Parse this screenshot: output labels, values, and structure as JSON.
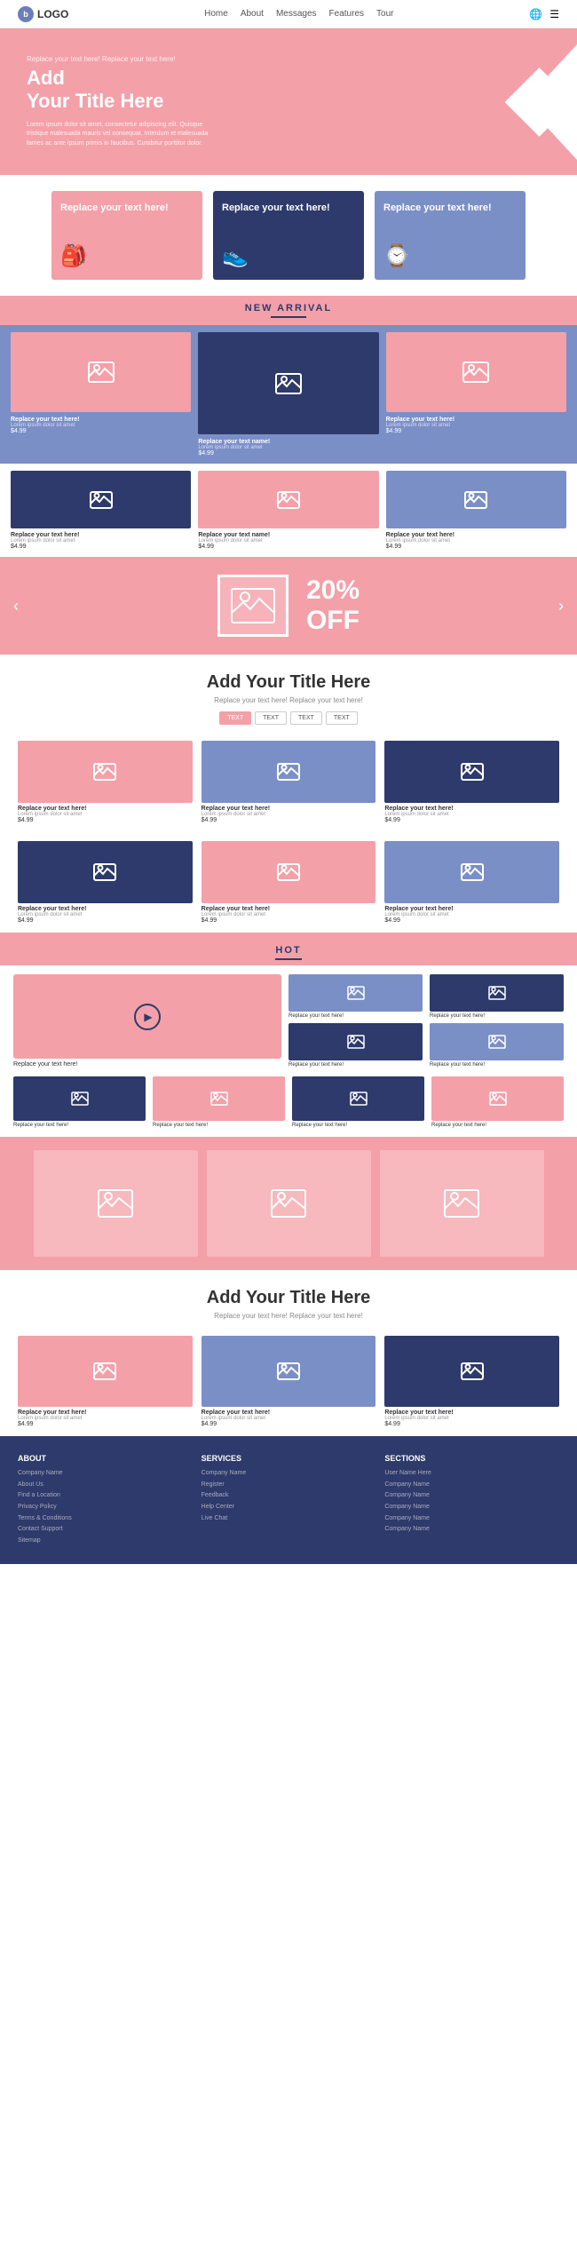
{
  "navbar": {
    "logo": "LOGO",
    "links": [
      "Home",
      "About",
      "Messages",
      "Features",
      "Tour"
    ],
    "icons": [
      "globe",
      "menu"
    ]
  },
  "hero": {
    "pre_title": "Replace your text here! Replace your text here!",
    "title": "Add\nYour Title Here",
    "body": "Lorem ipsum dolor sit amet, consectetur adipiscing elit. Quisque tristique malesuada mauris vel consequat. Interdum et malesuada fames ac ante ipsum primis in faucibus. Curabitur porttitor dolor."
  },
  "cards_row": [
    {
      "title": "Replace your text here!",
      "color": "pink"
    },
    {
      "title": "Replace your text here!",
      "color": "dark"
    },
    {
      "title": "Replace your text here!",
      "color": "blue"
    }
  ],
  "new_arrival": {
    "label": "NEW ARRIVAL"
  },
  "products_row1": [
    {
      "name": "Replace your text here!",
      "desc": "Lorem ipsum dolor sit amet",
      "price": "$4.99"
    },
    {
      "name": "Replace your text name!",
      "desc": "Lorem ipsum dolor sit amet",
      "price": "$4.99"
    },
    {
      "name": "Replace your text here!",
      "desc": "Lorem ipsum dolor sit amet",
      "price": "$4.99"
    }
  ],
  "products_row2": [
    {
      "name": "Replace your text here!",
      "desc": "Lorem ipsum dolor sit amet",
      "price": "$4.99"
    },
    {
      "name": "Replace your text name!",
      "desc": "Lorem ipsum dolor sit amet",
      "price": "$4.99"
    },
    {
      "name": "Replace your text here!",
      "desc": "Lorem ipsum dolor sit amet",
      "price": "$4.99"
    }
  ],
  "banner_sale": {
    "discount": "20%",
    "label": "OFF"
  },
  "section2_title": "Add Your Title Here",
  "section2_subtitle": "Replace your text here!  Replace your text here!",
  "section2_tabs": [
    "TEXT",
    "TEXT",
    "TEXT",
    "TEXT"
  ],
  "products_s2_row1": [
    {
      "name": "Replace your text here!",
      "desc": "Lorem ipsum dolor sit amet",
      "price": "$4.99"
    },
    {
      "name": "Replace your text here!",
      "desc": "Lorem ipsum dolor sit amet",
      "price": "$4.99"
    },
    {
      "name": "Replace your text here!",
      "desc": "Lorem ipsum dolor sit amet",
      "price": "$4.99"
    }
  ],
  "products_s2_row2": [
    {
      "name": "Replace your text here!",
      "desc": "Lorem ipsum dolor sit amet",
      "price": "$4.99"
    },
    {
      "name": "Replace your text here!",
      "desc": "Lorem ipsum dolor sit amet",
      "price": "$4.99"
    },
    {
      "name": "Replace your text here!",
      "desc": "Lorem ipsum dolor sit amet",
      "price": "$4.99"
    }
  ],
  "hot": {
    "label": "HOT",
    "video_label": "Replace your text here!",
    "items": [
      {
        "name": "Replace your text here!"
      },
      {
        "name": "Replace your text here!"
      },
      {
        "name": "Replace your text here!"
      },
      {
        "name": "Replace your text here!"
      }
    ]
  },
  "section3_title": "Add Your Title Here",
  "section3_subtitle": "Replace your text here!  Replace your text here!",
  "products_s3": [
    {
      "name": "Replace your text here!",
      "desc": "Lorem ipsum dolor sit amet",
      "price": "$4.99"
    },
    {
      "name": "Replace your text here!",
      "desc": "Lorem ipsum dolor sit amet",
      "price": "$4.99"
    },
    {
      "name": "Replace your text here!",
      "desc": "Lorem ipsum dolor sit amet",
      "price": "$4.99"
    }
  ],
  "footer": {
    "col1_title": "ABOUT",
    "col1_lines": [
      "Company Name",
      "About Us",
      "Find a Location",
      "Privacy Policy",
      "Terms & Conditions",
      "Contact Support",
      "Sitemap"
    ],
    "col2_title": "SERVICES",
    "col2_lines": [
      "Company Name",
      "Register",
      "Feedback",
      "Help Center",
      "Live Chat"
    ],
    "col3_title": "SECTIONS",
    "col3_lines": [
      "User Name Here",
      "Company Name",
      "Company Name",
      "Company Name",
      "Company Name",
      "Company Name"
    ]
  }
}
